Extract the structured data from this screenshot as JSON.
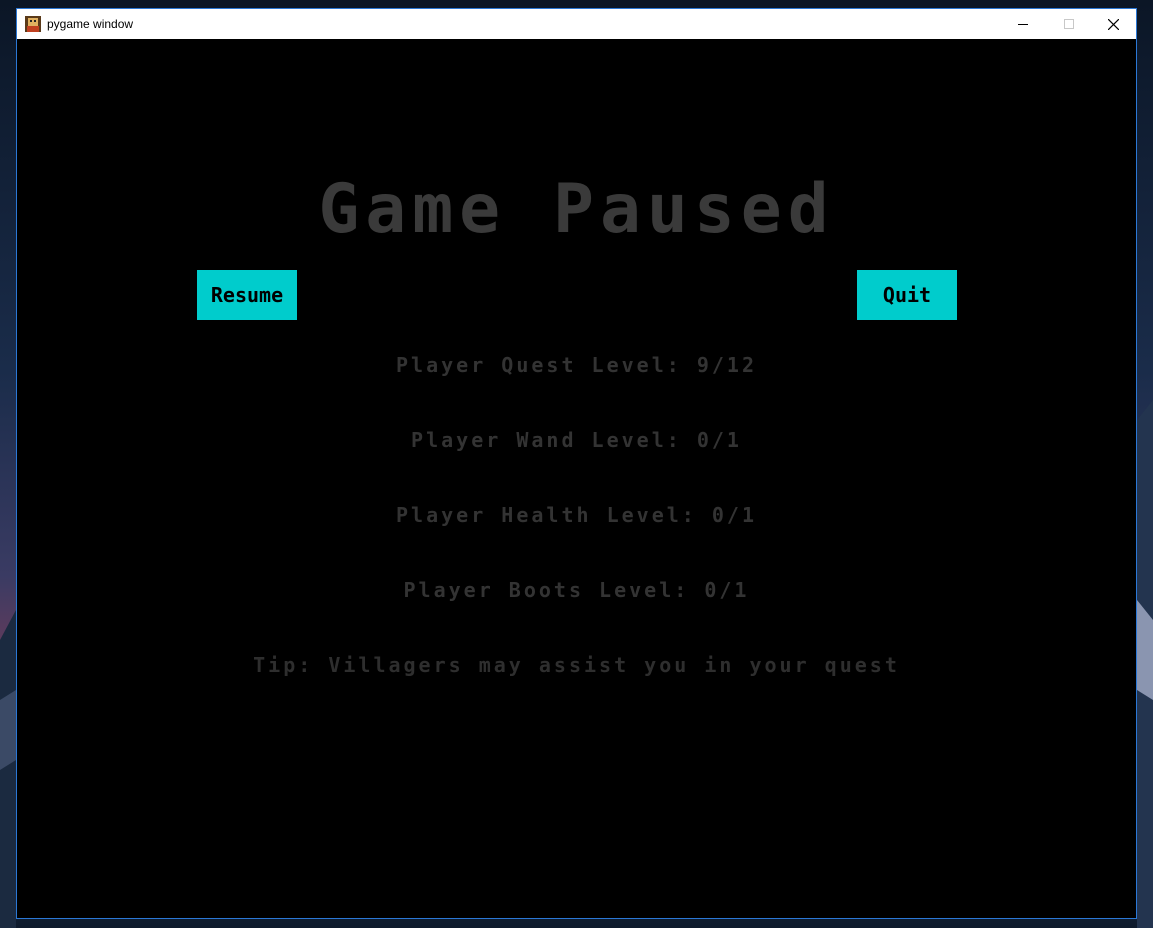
{
  "window": {
    "title": "pygame window"
  },
  "titlebar_buttons": {
    "minimize_icon": "minimize-icon",
    "maximize_icon": "maximize-icon",
    "close_icon": "close-icon"
  },
  "pause_menu": {
    "heading": "Game Paused",
    "resume_label": "Resume",
    "quit_label": "Quit",
    "stats": [
      "Player Quest Level: 9/12",
      "Player Wand Level: 0/1",
      "Player Health Level: 0/1",
      "Player Boots Level: 0/1"
    ],
    "tip": "Tip: Villagers may assist you in your quest"
  },
  "colors": {
    "button_bg": "#00cccc",
    "text_gray": "#333333",
    "heading_gray": "#3a3a3a",
    "game_bg": "#000000",
    "window_border": "#2b78d6"
  }
}
